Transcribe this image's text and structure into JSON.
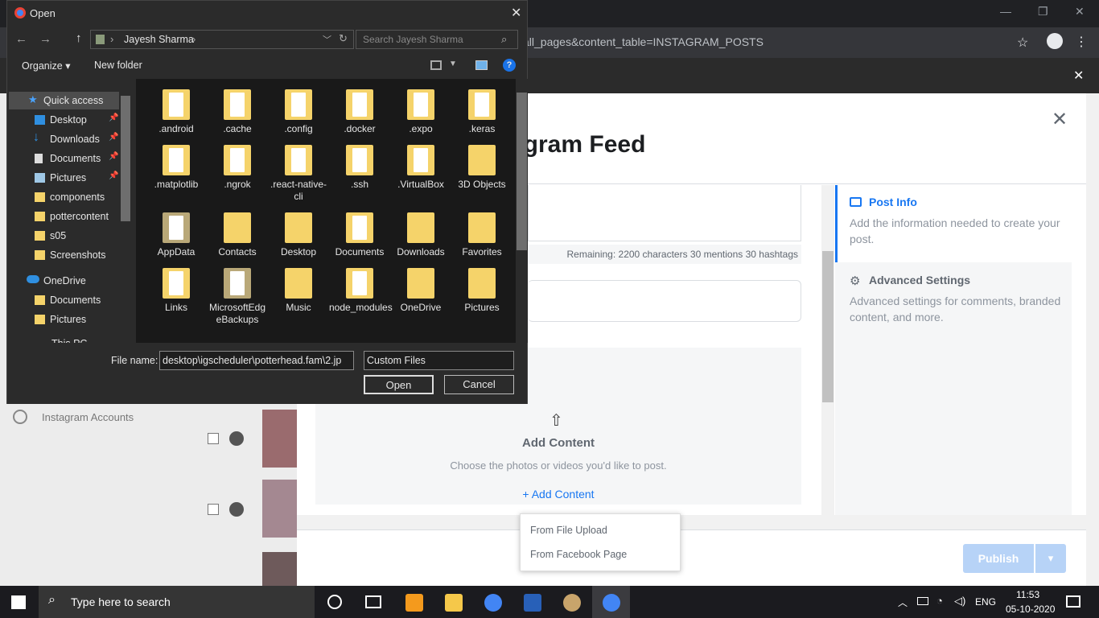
{
  "chrome": {
    "url": "all_pages&content_table=INSTAGRAM_POSTS",
    "minimize": "—",
    "restore": "❐",
    "close": "✕",
    "banner_close": "✕"
  },
  "page": {
    "modal_title": "agram Feed",
    "sidebar_nav_label": "Instagram Accounts",
    "remaining_text": "Remaining: 2200 characters 30 mentions 30 hashtags",
    "add_content_heading": "Add Content",
    "add_content_hint": "Choose the photos or videos you'd like to post.",
    "add_content_link": "+ Add Content",
    "popup_items": [
      "From File Upload",
      "From Facebook Page"
    ],
    "publish_label": "Publish",
    "side_panel": {
      "post_info_title": "Post Info",
      "post_info_desc": "Add the information needed to create your post.",
      "advanced_title": "Advanced Settings",
      "advanced_desc": "Advanced settings for comments, branded content, and more."
    }
  },
  "dialog": {
    "title": "Open",
    "breadcrumb": "Jayesh Sharma",
    "search_placeholder": "Search Jayesh Sharma",
    "organize": "Organize ▾",
    "new_folder": "New folder",
    "nav_items": [
      {
        "label": "Quick access"
      },
      {
        "label": "Desktop"
      },
      {
        "label": "Downloads"
      },
      {
        "label": "Documents"
      },
      {
        "label": "Pictures"
      },
      {
        "label": "components"
      },
      {
        "label": "pottercontent"
      },
      {
        "label": "s05"
      },
      {
        "label": "Screenshots"
      },
      {
        "label": "OneDrive"
      },
      {
        "label": "Documents"
      },
      {
        "label": "Pictures"
      },
      {
        "label": "This PC"
      }
    ],
    "files": [
      ".android",
      ".cache",
      ".config",
      ".docker",
      ".expo",
      ".keras",
      ".matplotlib",
      ".ngrok",
      ".react-native-cli",
      ".ssh",
      ".VirtualBox",
      "3D Objects",
      "AppData",
      "Contacts",
      "Desktop",
      "Documents",
      "Downloads",
      "Favorites",
      "Links",
      "MicrosoftEdgeBackups",
      "Music",
      "node_modules",
      "OneDrive",
      "Pictures"
    ],
    "file_name_label": "File name:",
    "file_name_value": "desktop\\igscheduler\\potterhead.fam\\2.jp",
    "file_type": "Custom Files",
    "open_label": "Open",
    "cancel_label": "Cancel"
  },
  "taskbar": {
    "search_placeholder": "Type here to search",
    "language": "ENG",
    "time": "11:53",
    "date": "05-10-2020"
  },
  "colors": {
    "accent": "#1877f2",
    "dialog_bg": "#2b2b2b",
    "folder": "#f5d36a",
    "publish_disabled": "#b7d3f7"
  }
}
